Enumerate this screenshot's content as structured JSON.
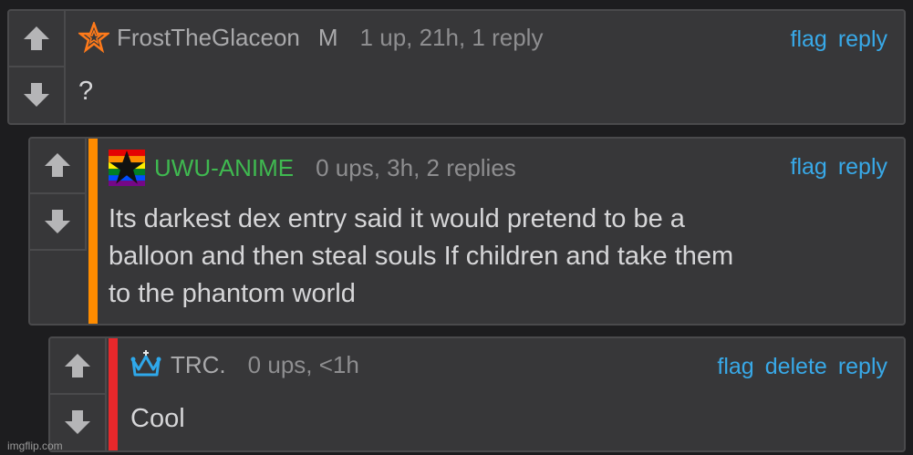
{
  "comments": [
    {
      "username": "FrostTheGlaceon",
      "mod_badge": "M",
      "stats": "1 up, 21h, 1 reply",
      "actions": [
        "flag",
        "reply"
      ],
      "text": "?",
      "badge_icon": "star-outline-icon",
      "username_color": "#a9a9ab"
    },
    {
      "username": "UWU-ANIME",
      "stats": "0 ups, 3h, 2 replies",
      "actions": [
        "flag",
        "reply"
      ],
      "text": "Its darkest dex entry said it would pretend to be a\nballoon and then steal souls If children and take them\nto the phantom world",
      "badge_icon": "rainbow-star-flag-icon",
      "username_color": "#3fb950",
      "stripe_color": "#ff8c00"
    },
    {
      "username": "TRC.",
      "stats": "0 ups, <1h",
      "actions": [
        "flag",
        "delete",
        "reply"
      ],
      "text": "Cool",
      "badge_icon": "crown-icon",
      "username_color": "#a9a9ab",
      "stripe_color": "#e8282b"
    }
  ],
  "watermark": "imgflip.com",
  "colors": {
    "background": "#1d1d1f",
    "panel": "#373739",
    "link": "#38a9e8"
  }
}
